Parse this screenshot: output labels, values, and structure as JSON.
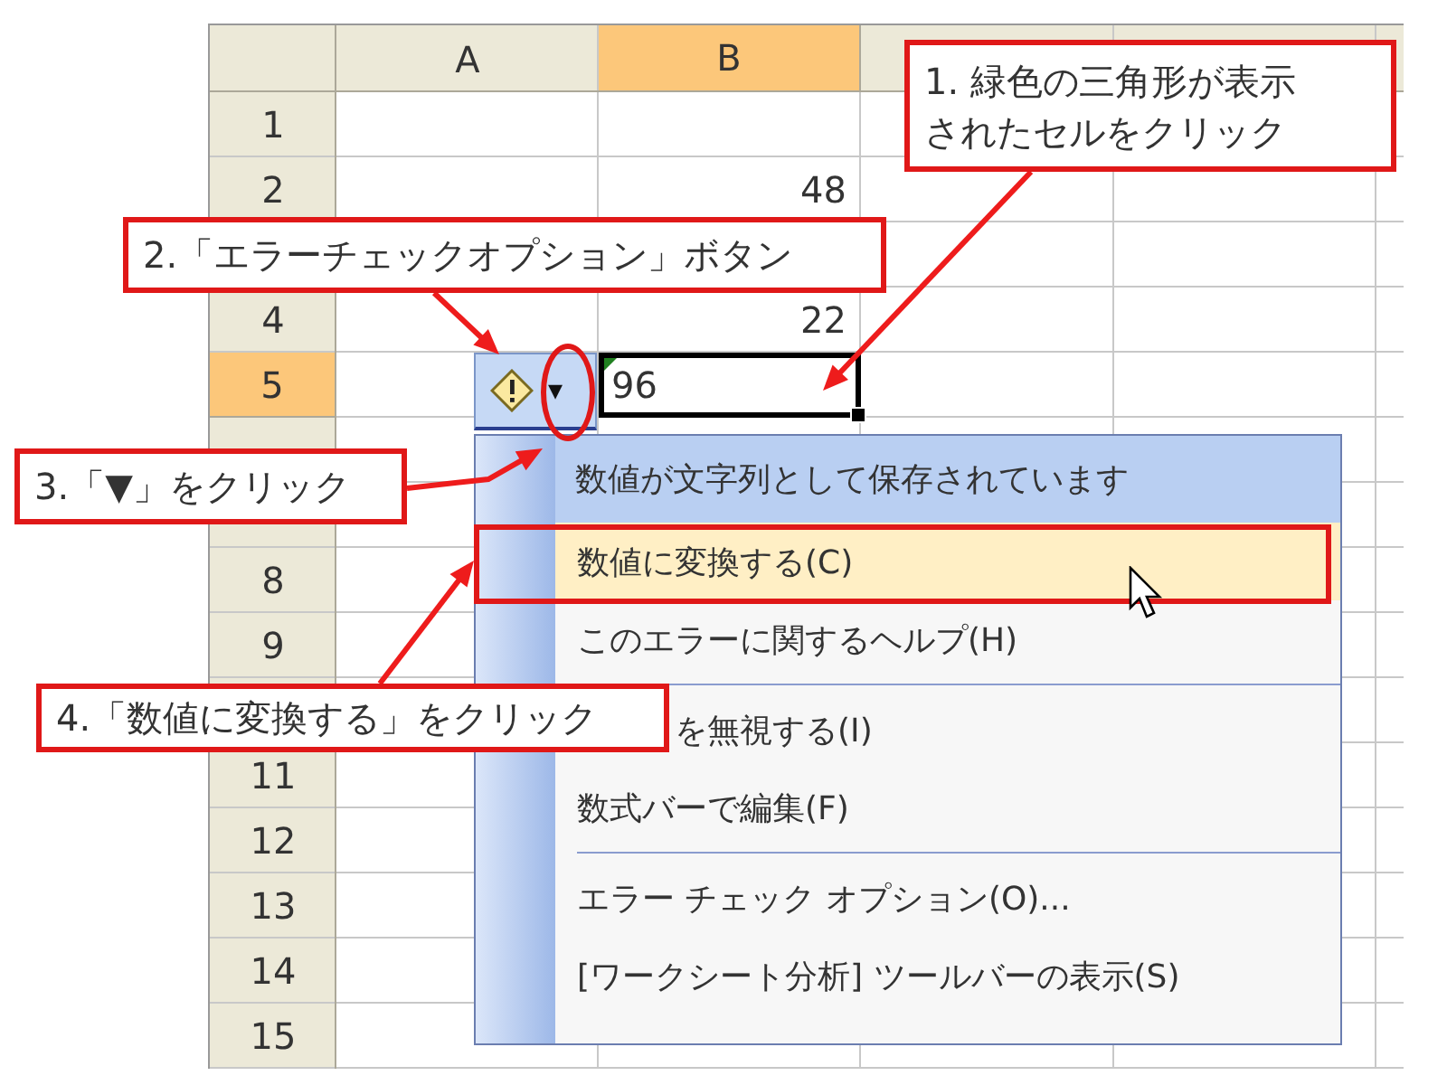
{
  "sheet": {
    "columns": [
      {
        "label": "A",
        "selected": false
      },
      {
        "label": "B",
        "selected": true
      }
    ],
    "rows": [
      {
        "header": "1",
        "selected": false
      },
      {
        "header": "2",
        "selected": false,
        "B": {
          "text": "48"
        }
      },
      {},
      {
        "header": "4",
        "selected": false,
        "B": {
          "text": "22"
        }
      },
      {
        "header": "5",
        "selected": true,
        "B": {
          "text": "96",
          "selected": true,
          "error_flag": true
        }
      },
      {},
      {},
      {
        "header": "8",
        "selected": false
      },
      {
        "header": "9",
        "selected": false
      },
      {},
      {
        "header": "11",
        "selected": false
      },
      {
        "header": "12",
        "selected": false
      },
      {
        "header": "13",
        "selected": false
      },
      {
        "header": "14",
        "selected": false
      },
      {
        "header": "15",
        "selected": false
      }
    ]
  },
  "error_button": {
    "dropdown": "▾"
  },
  "menu": {
    "title": "数値が文字列として保存されています",
    "items": [
      {
        "kind": "item",
        "label": "数値に変換する(C)",
        "selected": true
      },
      {
        "kind": "item",
        "label": "このエラーに関するヘルプ(H)",
        "selected": false
      },
      {
        "kind": "separator"
      },
      {
        "kind": "covered",
        "label": "を無視する(I)",
        "selected": false
      },
      {
        "kind": "item",
        "label": "数式バーで編集(F)",
        "selected": false
      },
      {
        "kind": "separator"
      },
      {
        "kind": "item",
        "label": "エラー チェック オプション(O)...",
        "selected": false
      },
      {
        "kind": "item",
        "label": "[ワークシート分析] ツールバーの表示(S)",
        "selected": false
      }
    ]
  },
  "callouts": [
    "1. 緑色の三角形が表示されたセルをクリック",
    "2.「エラーチェックオプション」ボタン",
    "3.「▼」をクリック",
    "4.「数値に変換する」をクリック"
  ]
}
